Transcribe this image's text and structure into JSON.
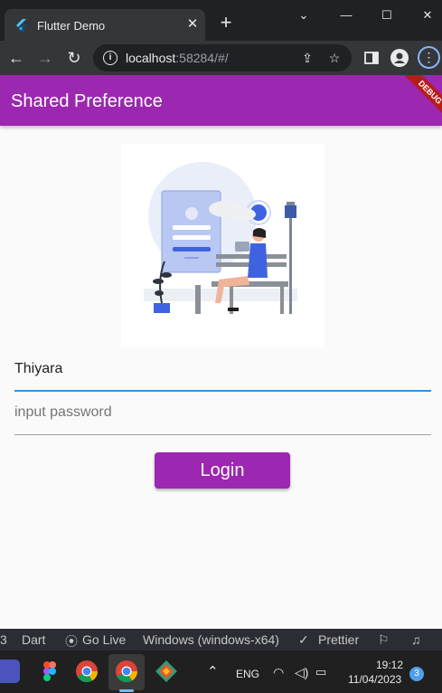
{
  "browser": {
    "tab_title": "Flutter Demo",
    "tab_close": "✕",
    "new_tab": "+",
    "window_controls": {
      "minimize": "⌄",
      "restore": "—",
      "maximize": "☐",
      "close": "✕"
    },
    "url_host": "localhost",
    "url_rest": ":58284/#/",
    "colors": {
      "tab_bar": "#202124",
      "toolbar": "#35363a"
    }
  },
  "app": {
    "title": "Shared Preference",
    "debug_banner": "DEBUG",
    "username_value": "Thiyara",
    "password_placeholder": "input password",
    "login_label": "Login",
    "colors": {
      "primary": "#9c27b0",
      "focus_line": "#3a8fd6",
      "debug": "#b71c1c"
    }
  },
  "statusbar": {
    "items": [
      "Dart",
      "Go Live",
      "Windows (windows-x64)",
      "Prettier"
    ],
    "leading": "3"
  },
  "taskbar": {
    "language": "ENG",
    "time": "19:12",
    "date": "11/04/2023",
    "notification_count": "3"
  }
}
